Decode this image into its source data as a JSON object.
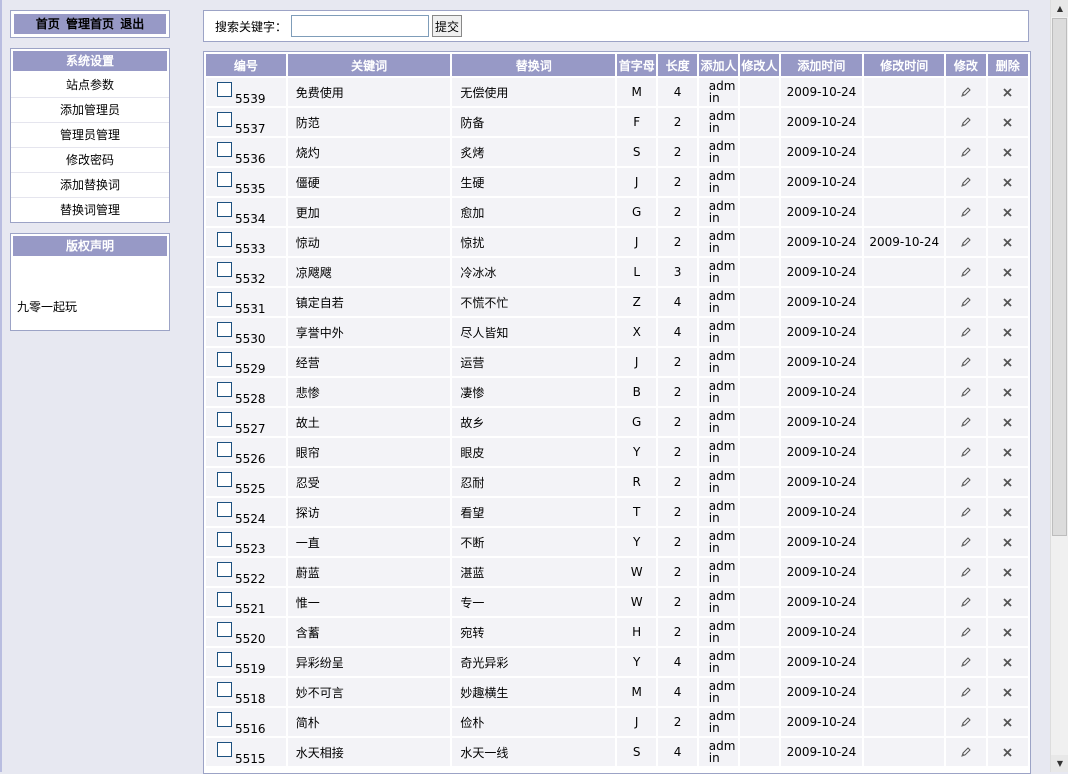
{
  "topnav": {
    "home": "首页",
    "admin_home": "管理首页",
    "logout": "退出"
  },
  "system": {
    "title": "系统设置",
    "items": [
      "站点参数",
      "添加管理员",
      "管理员管理",
      "修改密码",
      "添加替换词",
      "替换词管理"
    ]
  },
  "copyright": {
    "title": "版权声明",
    "text": "九零一起玩"
  },
  "search": {
    "label": "搜索关键字：",
    "value": "",
    "submit": "提交"
  },
  "table": {
    "headers": [
      "编号",
      "关键词",
      "替换词",
      "首字母",
      "长度",
      "添加人",
      "修改人",
      "添加时间",
      "修改时间",
      "修改",
      "删除"
    ],
    "rows": [
      {
        "id": "5539",
        "kw": "免费使用",
        "rep": "无偿使用",
        "initial": "M",
        "len": "4",
        "adder": "admin",
        "modifier": "",
        "added": "2009-10-24",
        "modified": ""
      },
      {
        "id": "5537",
        "kw": "防范",
        "rep": "防备",
        "initial": "F",
        "len": "2",
        "adder": "admin",
        "modifier": "",
        "added": "2009-10-24",
        "modified": ""
      },
      {
        "id": "5536",
        "kw": "烧灼",
        "rep": "炙烤",
        "initial": "S",
        "len": "2",
        "adder": "admin",
        "modifier": "",
        "added": "2009-10-24",
        "modified": ""
      },
      {
        "id": "5535",
        "kw": "僵硬",
        "rep": "生硬",
        "initial": "J",
        "len": "2",
        "adder": "admin",
        "modifier": "",
        "added": "2009-10-24",
        "modified": ""
      },
      {
        "id": "5534",
        "kw": "更加",
        "rep": "愈加",
        "initial": "G",
        "len": "2",
        "adder": "admin",
        "modifier": "",
        "added": "2009-10-24",
        "modified": ""
      },
      {
        "id": "5533",
        "kw": "惊动",
        "rep": "惊扰",
        "initial": "J",
        "len": "2",
        "adder": "admin",
        "modifier": "",
        "added": "2009-10-24",
        "modified": "2009-10-24"
      },
      {
        "id": "5532",
        "kw": "凉飕飕",
        "rep": "冷冰冰",
        "initial": "L",
        "len": "3",
        "adder": "admin",
        "modifier": "",
        "added": "2009-10-24",
        "modified": ""
      },
      {
        "id": "5531",
        "kw": "镇定自若",
        "rep": "不慌不忙",
        "initial": "Z",
        "len": "4",
        "adder": "admin",
        "modifier": "",
        "added": "2009-10-24",
        "modified": ""
      },
      {
        "id": "5530",
        "kw": "享誉中外",
        "rep": "尽人皆知",
        "initial": "X",
        "len": "4",
        "adder": "admin",
        "modifier": "",
        "added": "2009-10-24",
        "modified": ""
      },
      {
        "id": "5529",
        "kw": "经营",
        "rep": "运营",
        "initial": "J",
        "len": "2",
        "adder": "admin",
        "modifier": "",
        "added": "2009-10-24",
        "modified": ""
      },
      {
        "id": "5528",
        "kw": "悲惨",
        "rep": "凄惨",
        "initial": "B",
        "len": "2",
        "adder": "admin",
        "modifier": "",
        "added": "2009-10-24",
        "modified": ""
      },
      {
        "id": "5527",
        "kw": "故土",
        "rep": "故乡",
        "initial": "G",
        "len": "2",
        "adder": "admin",
        "modifier": "",
        "added": "2009-10-24",
        "modified": ""
      },
      {
        "id": "5526",
        "kw": "眼帘",
        "rep": "眼皮",
        "initial": "Y",
        "len": "2",
        "adder": "admin",
        "modifier": "",
        "added": "2009-10-24",
        "modified": ""
      },
      {
        "id": "5525",
        "kw": "忍受",
        "rep": "忍耐",
        "initial": "R",
        "len": "2",
        "adder": "admin",
        "modifier": "",
        "added": "2009-10-24",
        "modified": ""
      },
      {
        "id": "5524",
        "kw": "探访",
        "rep": "看望",
        "initial": "T",
        "len": "2",
        "adder": "admin",
        "modifier": "",
        "added": "2009-10-24",
        "modified": ""
      },
      {
        "id": "5523",
        "kw": "一直",
        "rep": "不断",
        "initial": "Y",
        "len": "2",
        "adder": "admin",
        "modifier": "",
        "added": "2009-10-24",
        "modified": ""
      },
      {
        "id": "5522",
        "kw": "蔚蓝",
        "rep": "湛蓝",
        "initial": "W",
        "len": "2",
        "adder": "admin",
        "modifier": "",
        "added": "2009-10-24",
        "modified": ""
      },
      {
        "id": "5521",
        "kw": "惟一",
        "rep": "专一",
        "initial": "W",
        "len": "2",
        "adder": "admin",
        "modifier": "",
        "added": "2009-10-24",
        "modified": ""
      },
      {
        "id": "5520",
        "kw": "含蓄",
        "rep": "宛转",
        "initial": "H",
        "len": "2",
        "adder": "admin",
        "modifier": "",
        "added": "2009-10-24",
        "modified": ""
      },
      {
        "id": "5519",
        "kw": "异彩纷呈",
        "rep": "奇光异彩",
        "initial": "Y",
        "len": "4",
        "adder": "admin",
        "modifier": "",
        "added": "2009-10-24",
        "modified": ""
      },
      {
        "id": "5518",
        "kw": "妙不可言",
        "rep": "妙趣横生",
        "initial": "M",
        "len": "4",
        "adder": "admin",
        "modifier": "",
        "added": "2009-10-24",
        "modified": ""
      },
      {
        "id": "5516",
        "kw": "简朴",
        "rep": "俭朴",
        "initial": "J",
        "len": "2",
        "adder": "admin",
        "modifier": "",
        "added": "2009-10-24",
        "modified": ""
      },
      {
        "id": "5515",
        "kw": "水天相接",
        "rep": "水天一线",
        "initial": "S",
        "len": "4",
        "adder": "admin",
        "modifier": "",
        "added": "2009-10-24",
        "modified": ""
      }
    ]
  },
  "icons": {
    "edit": "pencil-icon",
    "delete": "x-icon"
  },
  "colors": {
    "header_bg": "#9799c6",
    "page_bg": "#e7e8f1",
    "cell_bg": "#f3f3f7"
  }
}
